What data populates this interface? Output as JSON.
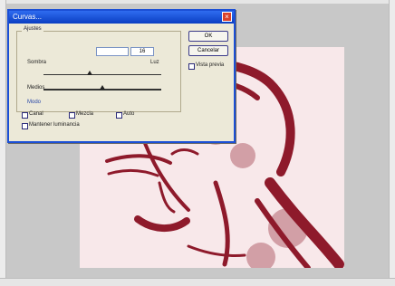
{
  "dialog": {
    "title": "Curvas...",
    "close_glyph": "×",
    "group_label": "Ajustes",
    "input_values": [
      "",
      "16"
    ],
    "labels": {
      "left": "Sombra",
      "mid": "Medios",
      "right": "Luz",
      "sub": "Modo"
    },
    "buttons": {
      "ok": "OK",
      "cancel": "Cancelar",
      "preview": "Vista previa"
    },
    "options": [
      "Canal",
      "Mezcla",
      "Auto"
    ],
    "footer_check": "Mantener luminancia"
  },
  "colors": {
    "accent": "#1b4fd6",
    "ink": "#8e1a2b",
    "canvas_bg": "#f8e8ea"
  }
}
